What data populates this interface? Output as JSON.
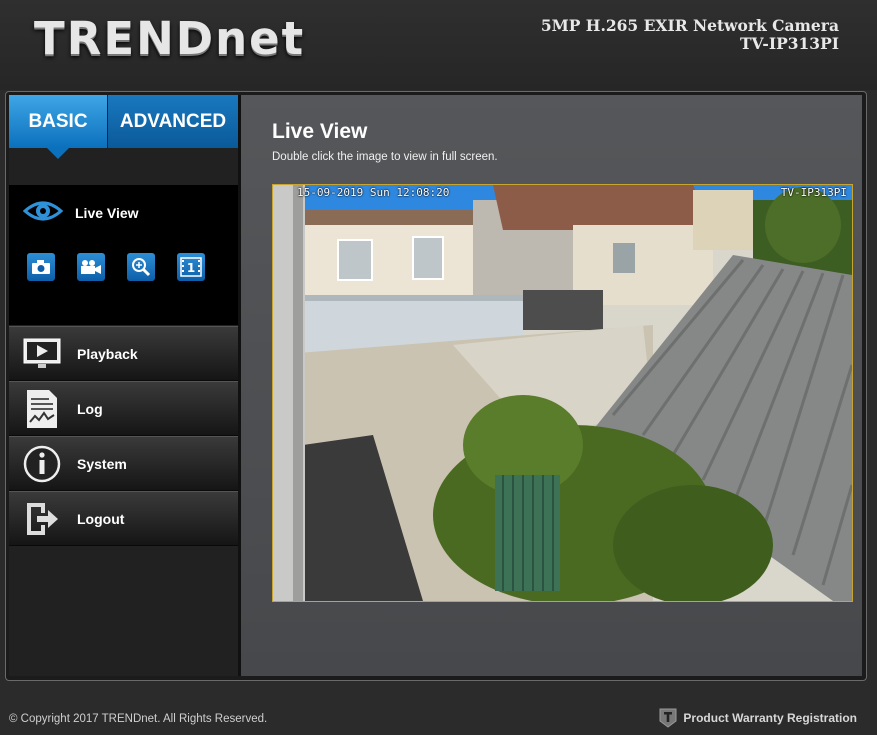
{
  "header": {
    "logo_text": "TRENDnet",
    "product_line": "5MP H.265 EXIR Network Camera",
    "model": "TV-IP313PI"
  },
  "tabs": {
    "basic": "BASIC",
    "advanced": "ADVANCED"
  },
  "menu": {
    "live_view": "Live View",
    "sub_icons": [
      "camera-icon",
      "video-camera-icon",
      "zoom-icon",
      "single-view-icon"
    ],
    "items": [
      "Playback",
      "Log",
      "System",
      "Logout"
    ]
  },
  "main": {
    "title": "Live View",
    "subtitle": "Double click the image to view in full screen.",
    "osd_timestamp": "15-09-2019 Sun 12:08:20",
    "osd_camera_name": "TV-IP313PI"
  },
  "footer": {
    "copyright": "© Copyright 2017 TRENDnet. All Rights Reserved.",
    "warranty": "Product Warranty Registration"
  },
  "colors": {
    "accent_blue": "#0c71bd",
    "video_border": "#c8a431"
  }
}
